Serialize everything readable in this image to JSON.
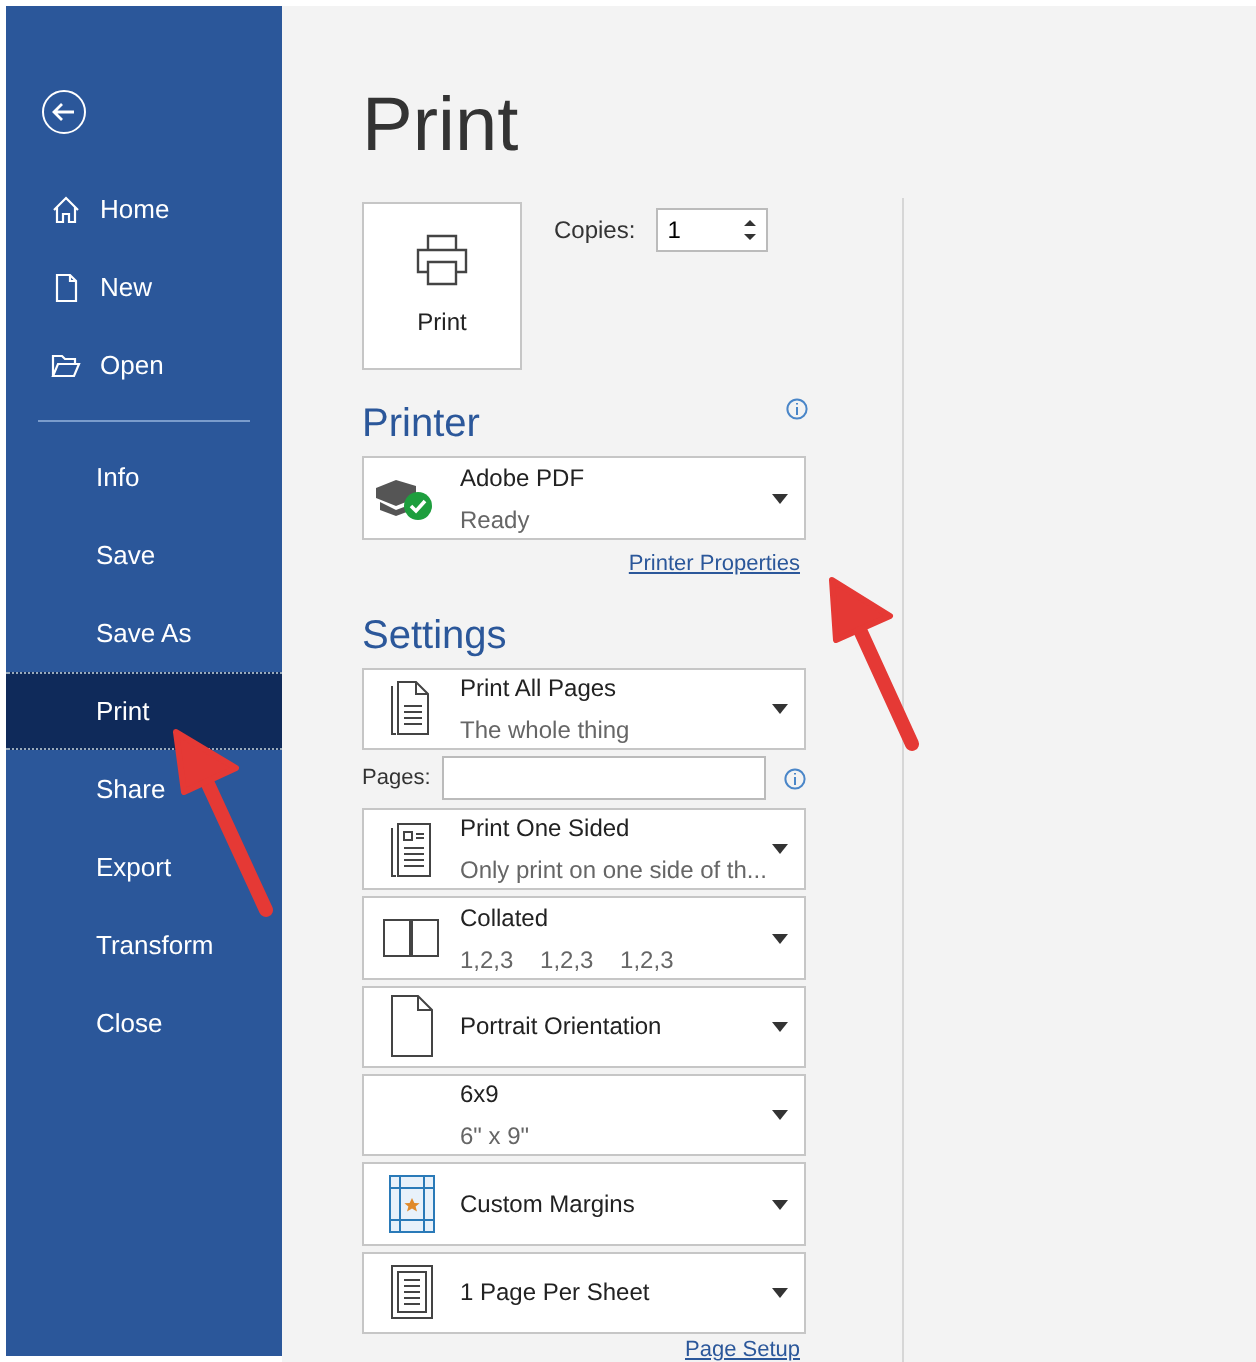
{
  "sidebar": {
    "top_items": [
      {
        "label": "Home",
        "kind": "home",
        "selected": false
      },
      {
        "label": "New",
        "kind": "new",
        "selected": false
      },
      {
        "label": "Open",
        "kind": "open",
        "selected": false
      }
    ],
    "items": [
      {
        "label": "Info",
        "selected": false
      },
      {
        "label": "Save",
        "selected": false
      },
      {
        "label": "Save As",
        "selected": false
      },
      {
        "label": "Print",
        "selected": true
      },
      {
        "label": "Share",
        "selected": false
      },
      {
        "label": "Export",
        "selected": false
      },
      {
        "label": "Transform",
        "selected": false
      },
      {
        "label": "Close",
        "selected": false
      }
    ]
  },
  "title": "Print",
  "print_button": {
    "label": "Print"
  },
  "copies": {
    "label": "Copies:",
    "value": "1"
  },
  "printer": {
    "heading": "Printer",
    "name": "Adobe PDF",
    "status": "Ready",
    "link": "Printer Properties"
  },
  "settings": {
    "heading": "Settings",
    "pages_label": "Pages:",
    "link": "Page Setup",
    "dropdowns": [
      {
        "kind": "pages",
        "title": "Print All Pages",
        "subtitle": "The whole thing"
      },
      {
        "kind": "sided",
        "title": "Print One Sided",
        "subtitle": "Only print on one side of th..."
      },
      {
        "kind": "collated",
        "title": "Collated",
        "subtitle": "1,2,3    1,2,3    1,2,3"
      },
      {
        "kind": "portrait",
        "title": "Portrait Orientation"
      },
      {
        "kind": "size",
        "title": "6x9",
        "subtitle": "6\" x 9\""
      },
      {
        "kind": "margins",
        "title": "Custom Margins"
      },
      {
        "kind": "sheet",
        "title": "1 Page Per Sheet"
      }
    ]
  }
}
